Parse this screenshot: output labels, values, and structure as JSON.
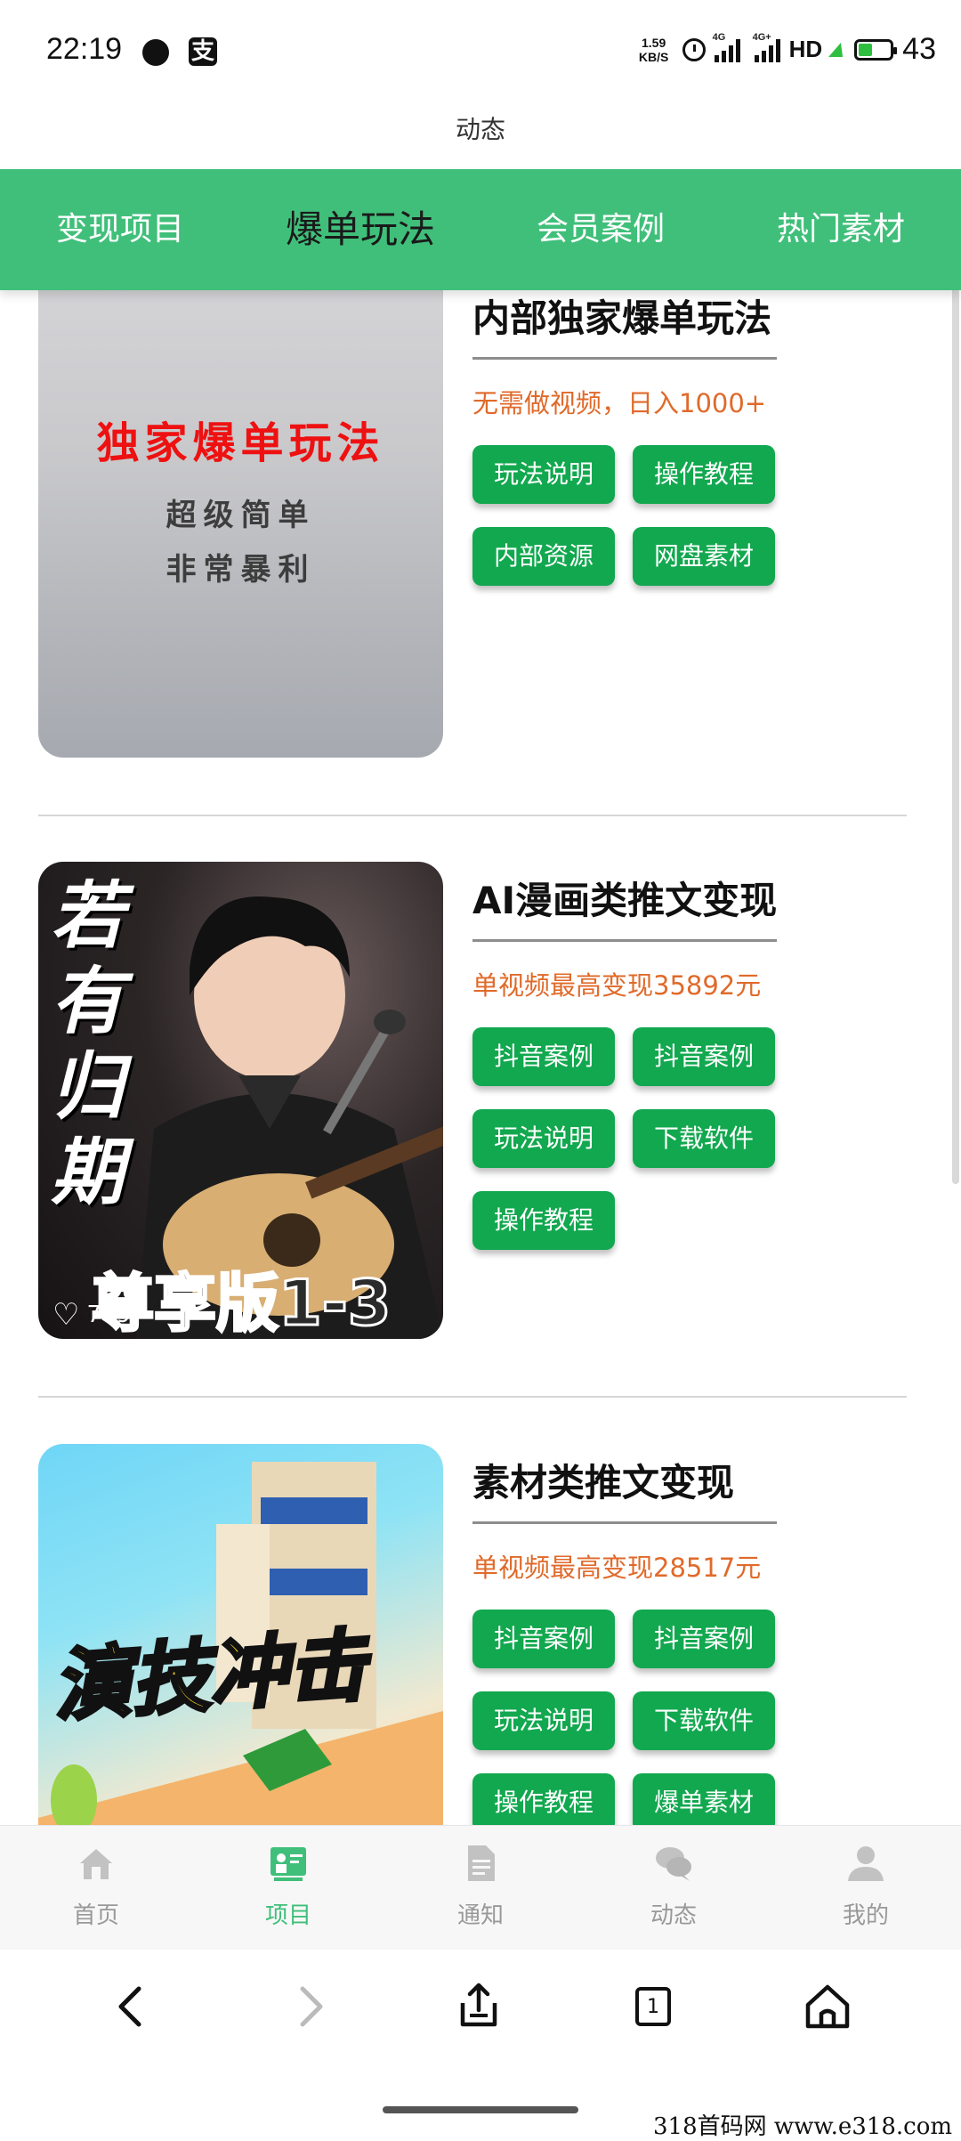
{
  "status_bar": {
    "time": "22:19",
    "alipay_glyph": "支",
    "speed_value": "1.59",
    "speed_unit": "KB/S",
    "sig1_label": "4G",
    "sig2_label": "4G+",
    "hd": "HD",
    "battery": "43",
    "battery_level": 0.43,
    "icons": [
      "chat-bubble-icon",
      "alipay-icon",
      "alarm-icon",
      "signal-icon",
      "charging-icon",
      "battery-icon"
    ]
  },
  "header": {
    "title": "动态"
  },
  "tabs": [
    {
      "label": "变现项目",
      "active": false
    },
    {
      "label": "爆单玩法",
      "active": true
    },
    {
      "label": "会员案例",
      "active": false
    },
    {
      "label": "热门素材",
      "active": false
    }
  ],
  "cards": [
    {
      "title": "内部独家爆单玩法",
      "subtitle": "无需做视频，日入1000+",
      "thumb_lines": [
        "独家爆单玩法",
        "超级简单",
        "非常暴利"
      ],
      "buttons": [
        "玩法说明",
        "操作教程",
        "内部资源",
        "网盘素材"
      ]
    },
    {
      "title": "AI漫画类推文变现",
      "subtitle": "单视频最高变现35892元",
      "thumb_vertical": [
        "若",
        "有",
        "归",
        "期"
      ],
      "thumb_caption": "尊享版1-3",
      "thumb_likes": "7897",
      "buttons": [
        "抖音案例",
        "抖音案例",
        "玩法说明",
        "下载软件",
        "操作教程"
      ]
    },
    {
      "title": "素材类推文变现",
      "subtitle": "单视频最高变现28517元",
      "thumb_caption": "演技冲击",
      "buttons": [
        "抖音案例",
        "抖音案例",
        "玩法说明",
        "下载软件",
        "操作教程",
        "爆单素材"
      ]
    }
  ],
  "bottom_nav": [
    {
      "label": "首页",
      "icon": "home-icon",
      "active": false
    },
    {
      "label": "项目",
      "icon": "project-icon",
      "active": true
    },
    {
      "label": "通知",
      "icon": "document-icon",
      "active": false
    },
    {
      "label": "动态",
      "icon": "chat-icon",
      "active": false
    },
    {
      "label": "我的",
      "icon": "user-icon",
      "active": false
    }
  ],
  "browser_toolbar": {
    "tab_count": "1",
    "icons": [
      "back-icon",
      "forward-icon",
      "share-icon",
      "tabs-icon",
      "home-icon"
    ]
  },
  "watermark": "318首码网  www.e318.com",
  "colors": {
    "tab_bar": "#40bf7a",
    "button": "#12a84f",
    "subtitle": "#e06a2a",
    "nav_active": "#40bf7a"
  }
}
